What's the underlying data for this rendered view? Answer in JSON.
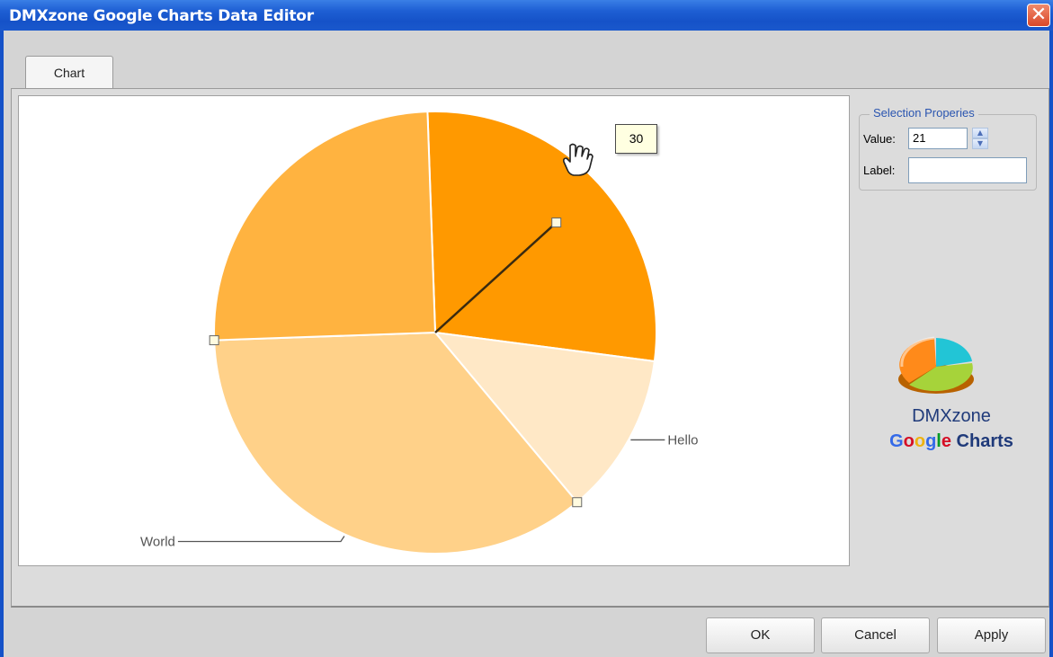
{
  "window": {
    "title": "DMXzone Google Charts Data Editor",
    "close_glyph": "✕"
  },
  "tabs": [
    {
      "label": "Chart",
      "active": true
    }
  ],
  "selection": {
    "group_title": "Selection Properies",
    "value_label": "Value:",
    "value": "21",
    "label_label": "Label:",
    "label_value": ""
  },
  "tooltip": {
    "text": "30"
  },
  "brand": {
    "line1": "DMXzone",
    "google": [
      "G",
      "o",
      "o",
      "g",
      "l",
      "e"
    ],
    "charts": "Charts"
  },
  "buttons": {
    "ok": "OK",
    "cancel": "Cancel",
    "apply": "Apply"
  },
  "chart_data": {
    "type": "pie",
    "slices": [
      {
        "label": "",
        "value": 21,
        "color": "#ff9900"
      },
      {
        "label": "Hello",
        "value": 9,
        "color": "#ffe8c6"
      },
      {
        "label": "World",
        "value": 27,
        "color": "#ffd189"
      },
      {
        "label": "",
        "value": 19,
        "color": "#ffb340"
      }
    ],
    "start_angle_deg": -2,
    "legend": "none"
  },
  "colors": {
    "title_bar": "#1552c8",
    "accent": "#ff9900",
    "google": [
      "#3369e8",
      "#d50f25",
      "#eeb211",
      "#3369e8",
      "#009925",
      "#d50f25"
    ]
  },
  "icons": {
    "close": "close-icon",
    "cursor": "hand-cursor-icon",
    "logo": "pie-chart-logo-icon",
    "spin_up": "spin-up-icon",
    "spin_down": "spin-down-icon"
  }
}
